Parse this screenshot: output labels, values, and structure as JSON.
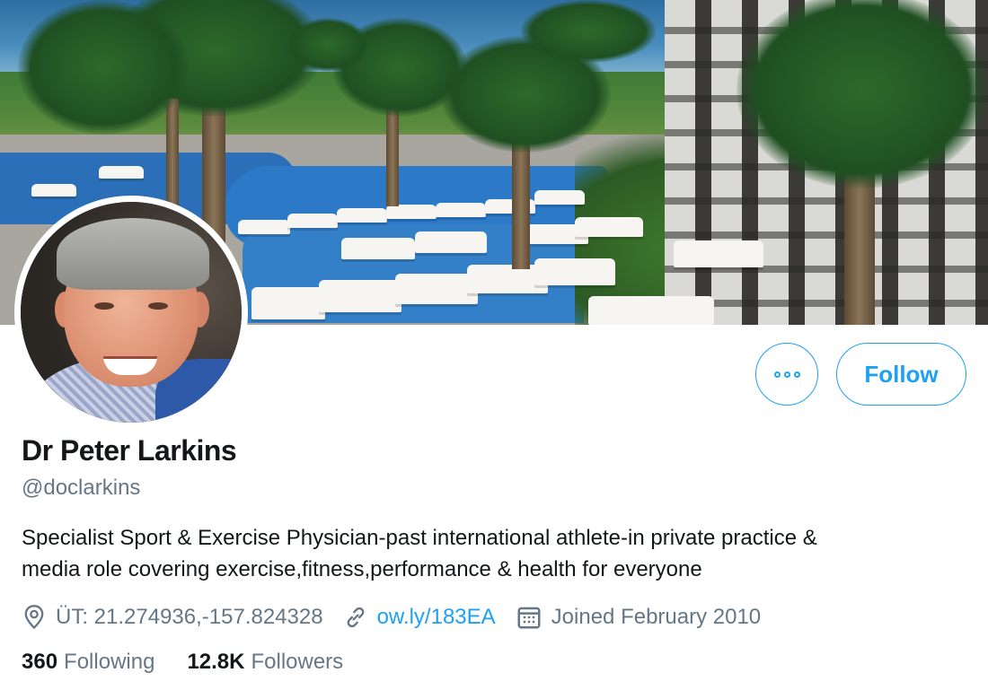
{
  "profile": {
    "name": "Dr Peter Larkins",
    "handle": "@doclarkins",
    "bio_line1": "Specialist Sport & Exercise Physician-past international athlete-in private practice &",
    "bio_line2": "media role covering exercise,fitness,performance & health for everyone",
    "location": "ÜT: 21.274936,-157.824328",
    "website": "ow.ly/183EA",
    "joined": "Joined February 2010"
  },
  "stats": {
    "following_count": "360",
    "following_label": "Following",
    "followers_count": "12.8K",
    "followers_label": "Followers"
  },
  "actions": {
    "follow_label": "Follow",
    "more_icon": "more-dots-icon"
  },
  "icons": {
    "location": "location-pin-icon",
    "link": "link-icon",
    "calendar": "calendar-icon"
  },
  "colors": {
    "accent": "#1da1f2",
    "secondary_text": "#657786",
    "primary_text": "#14171a"
  }
}
